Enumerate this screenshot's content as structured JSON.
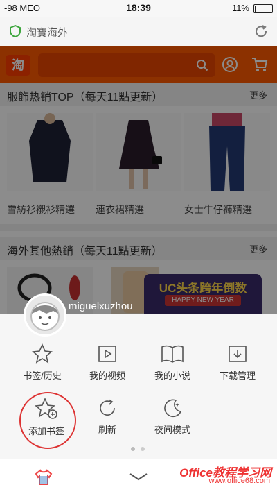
{
  "status": {
    "carrier": "-98 MEO",
    "time": "18:39",
    "battery": "11%",
    "battery_level": 0.11
  },
  "urlbar": {
    "title": "淘寶海外"
  },
  "web": {
    "logo": "淘",
    "section1": {
      "title": "服飾热销TOP（每天11點更新）",
      "more": "更多"
    },
    "products1": [
      "雪紡衫襯衫精選",
      "連衣裙精選",
      "女士牛仔褲精選"
    ],
    "section2": {
      "title": "海外其他熱銷（每天11點更新）",
      "more": "更多"
    },
    "promo": {
      "title": "UC头条跨年倒数",
      "subtitle": "HAPPY NEW YEAR"
    }
  },
  "menu": {
    "username": "miguelxuzhou",
    "row1": [
      "书签/历史",
      "我的视频",
      "我的小说",
      "下载管理"
    ],
    "row2": [
      "添加书签",
      "刷新",
      "夜间模式"
    ]
  },
  "watermark": {
    "brand": "Office教程学习网",
    "url": "www.office68.com"
  }
}
